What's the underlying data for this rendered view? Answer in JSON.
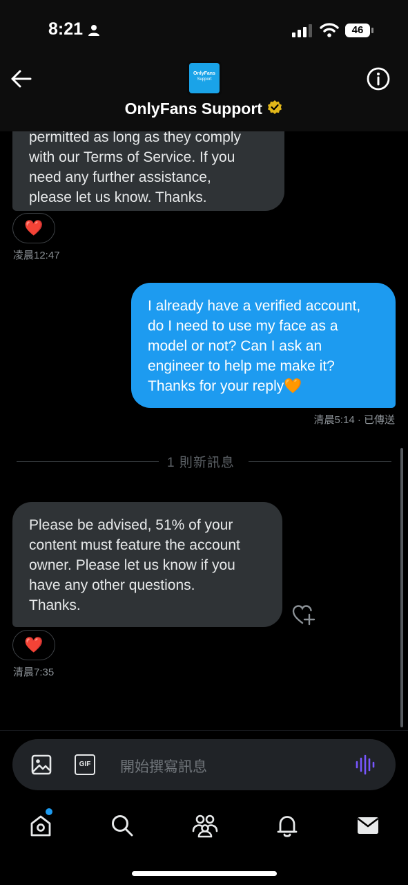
{
  "status_bar": {
    "time": "8:21",
    "battery": "46"
  },
  "header": {
    "title": "OnlyFans Support",
    "avatar_line1": "OnlyFans",
    "avatar_line2": "Support",
    "back_icon": "arrow-left-icon",
    "info_icon": "info-icon",
    "verified_icon": "verified-badge-icon"
  },
  "messages": [
    {
      "direction": "incoming",
      "lines": [
        "permitted as long as they comply",
        "with our Terms of Service. If you",
        "need any further assistance,",
        "please let us know. Thanks."
      ],
      "reaction": "❤️",
      "timestamp": "凌晨12:47"
    },
    {
      "direction": "outgoing",
      "lines": [
        "I already have a verified account,",
        "do I need to use my face as a",
        "model or not?  Can I ask an",
        "engineer to help me make it?",
        "Thanks for your reply🧡"
      ],
      "timestamp": "清晨5:14 · 已傳送"
    },
    {
      "direction": "incoming",
      "lines": [
        "Please be advised, 51% of your",
        "content must feature the account",
        "owner. Please let us know if you",
        "have any other questions.",
        "Thanks."
      ],
      "reaction": "❤️",
      "timestamp": "清晨7:35"
    }
  ],
  "divider": {
    "label": "1 則新訊息"
  },
  "composer": {
    "placeholder": "開始撰寫訊息",
    "gif_label": "GIF"
  },
  "tabs": [
    {
      "name": "home",
      "icon": "home-icon",
      "badge": true
    },
    {
      "name": "search",
      "icon": "search-icon"
    },
    {
      "name": "communities",
      "icon": "people-icon"
    },
    {
      "name": "notifications",
      "icon": "bell-icon"
    },
    {
      "name": "messages",
      "icon": "mail-icon"
    }
  ],
  "colors": {
    "accent": "#1d9bf0",
    "incoming_bubble": "#2f3336",
    "voice_icon": "#7856ff",
    "verified_gold": "#e2b719"
  }
}
